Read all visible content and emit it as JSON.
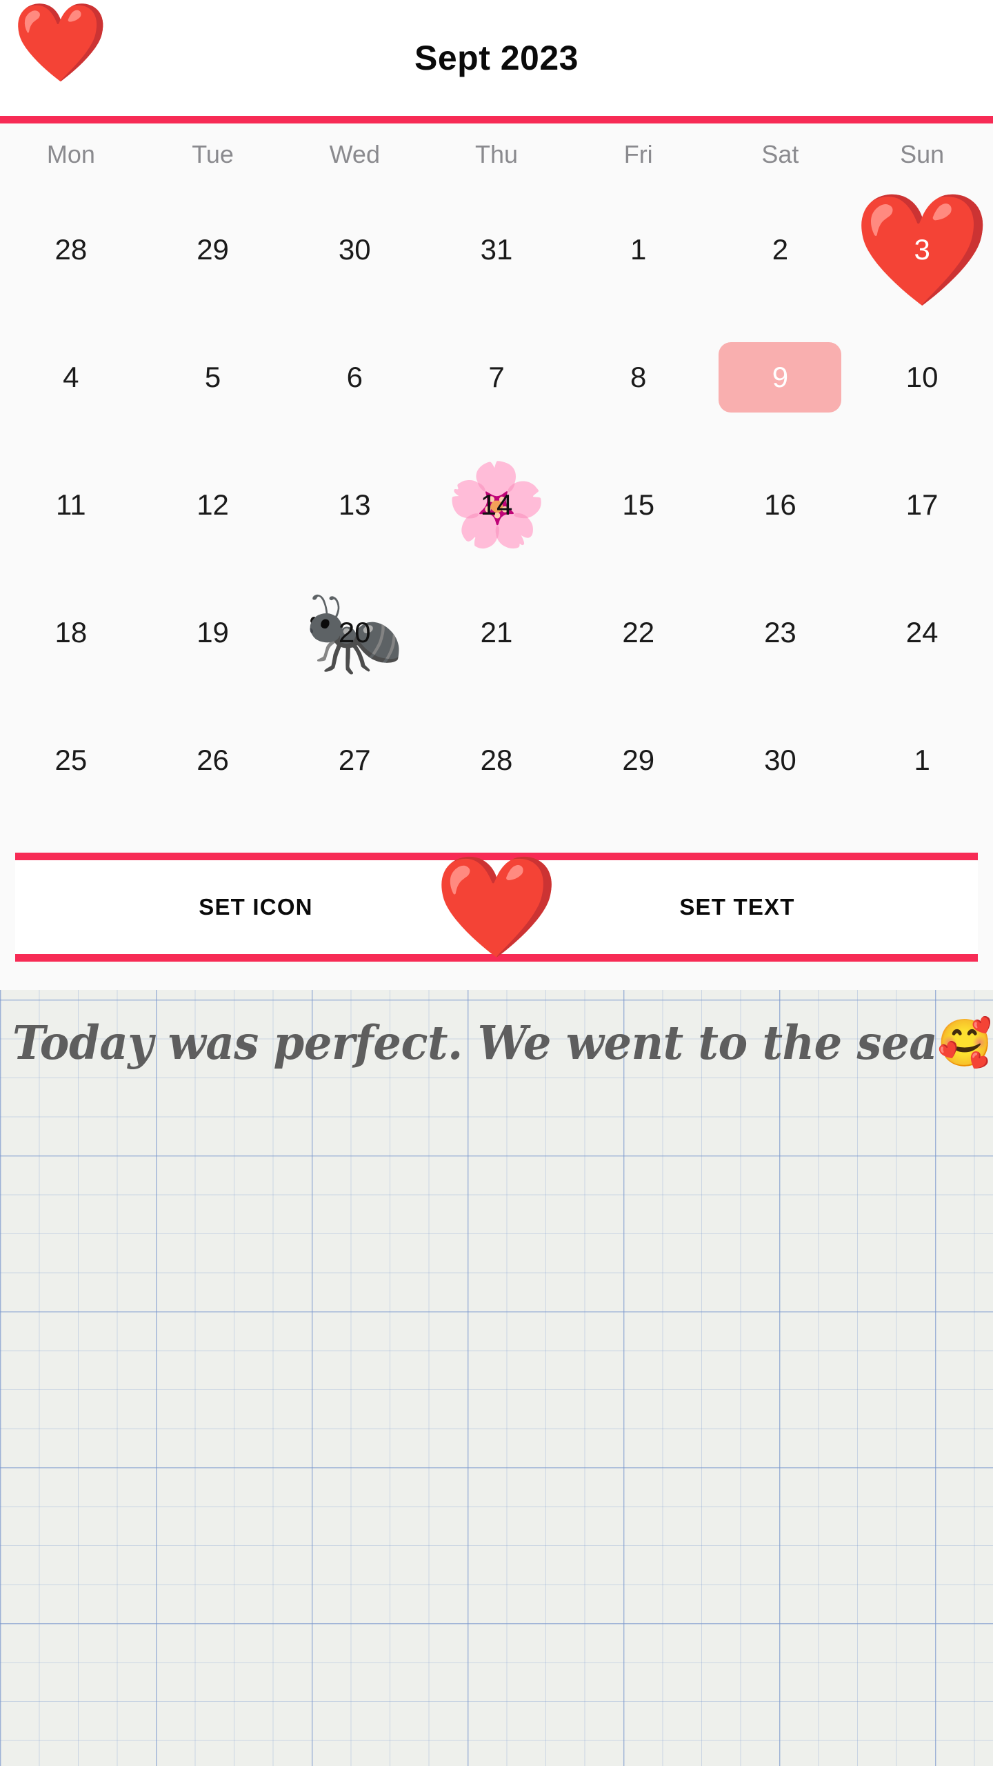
{
  "header": {
    "title": "Sept 2023",
    "heart_icon": "❤️"
  },
  "calendar": {
    "weekdays": [
      "Mon",
      "Tue",
      "Wed",
      "Thu",
      "Fri",
      "Sat",
      "Sun"
    ],
    "rows": [
      [
        {
          "day": "28"
        },
        {
          "day": "29"
        },
        {
          "day": "30"
        },
        {
          "day": "31"
        },
        {
          "day": "1"
        },
        {
          "day": "2"
        },
        {
          "day": "3",
          "emoji": "❤️",
          "emoji_size": "big",
          "num_style": "white"
        }
      ],
      [
        {
          "day": "4"
        },
        {
          "day": "5"
        },
        {
          "day": "6"
        },
        {
          "day": "7"
        },
        {
          "day": "8"
        },
        {
          "day": "9",
          "highlight": true
        },
        {
          "day": "10"
        }
      ],
      [
        {
          "day": "11"
        },
        {
          "day": "12"
        },
        {
          "day": "13"
        },
        {
          "day": "14",
          "emoji": "🌸",
          "num_style": "dark"
        },
        {
          "day": "15"
        },
        {
          "day": "16"
        },
        {
          "day": "17"
        }
      ],
      [
        {
          "day": "18"
        },
        {
          "day": "19"
        },
        {
          "day": "20",
          "emoji": "🐜",
          "num_style": "dark"
        },
        {
          "day": "21"
        },
        {
          "day": "22"
        },
        {
          "day": "23"
        },
        {
          "day": "24"
        }
      ],
      [
        {
          "day": "25"
        },
        {
          "day": "26"
        },
        {
          "day": "27"
        },
        {
          "day": "28"
        },
        {
          "day": "29"
        },
        {
          "day": "30"
        },
        {
          "day": "1"
        }
      ]
    ]
  },
  "action_bar": {
    "set_icon_label": "SET ICON",
    "set_text_label": "SET TEXT",
    "center_heart_icon": "❤️"
  },
  "note": {
    "text": "Today was perfect. We went to the sea",
    "emoji": "🥰"
  },
  "colors": {
    "accent_rule": "#F72B55",
    "highlight_box": "#F9AFAF",
    "weekday_label": "#8A8A8E",
    "day_number": "#1A1A1A",
    "note_text": "#5E5E5E",
    "graph_paper_bg": "#EEF0EC",
    "graph_line": "#7896CD"
  }
}
